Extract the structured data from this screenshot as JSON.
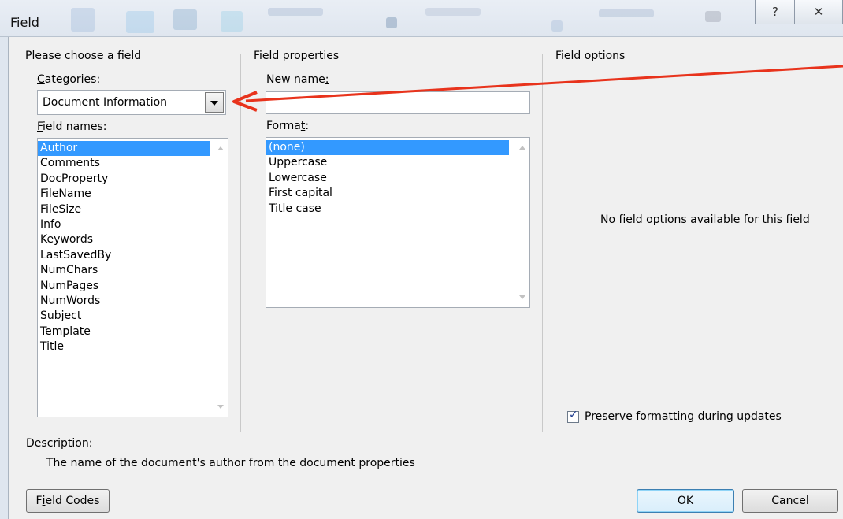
{
  "window": {
    "title": "Field",
    "help_glyph": "?",
    "close_glyph": "✕"
  },
  "left_panel": {
    "group_label": "Please choose a field",
    "categories_label": "Categories:",
    "categories_accel": "C",
    "categories_rest": "ategories:",
    "categories_value": "Document Information",
    "field_names_accel": "F",
    "field_names_rest": "ield names:",
    "field_names": [
      "Author",
      "Comments",
      "DocProperty",
      "FileName",
      "FileSize",
      "Info",
      "Keywords",
      "LastSavedBy",
      "NumChars",
      "NumPages",
      "NumWords",
      "Subject",
      "Template",
      "Title"
    ],
    "selected_field": "Author"
  },
  "middle_panel": {
    "group_label": "Field properties",
    "new_name_prefix": "New name",
    "new_name_accel": ":",
    "new_name_value": "",
    "format_prefix": "Forma",
    "format_accel": "t",
    "format_suffix": ":",
    "formats": [
      "(none)",
      "Uppercase",
      "Lowercase",
      "First capital",
      "Title case"
    ],
    "selected_format": "(none)"
  },
  "right_panel": {
    "group_label": "Field options",
    "no_options_text": "No field options available for this field",
    "preserve_prefix": "Preser",
    "preserve_accel": "v",
    "preserve_suffix": "e formatting during updates",
    "preserve_checked": true
  },
  "description": {
    "label": "Description:",
    "text": "The name of the document's author from the document properties"
  },
  "buttons": {
    "field_codes_prefix": "F",
    "field_codes_accel": "i",
    "field_codes_suffix": "eld Codes",
    "ok": "OK",
    "cancel": "Cancel"
  },
  "colors": {
    "selection": "#3399ff",
    "arrow": "#e8331c"
  }
}
